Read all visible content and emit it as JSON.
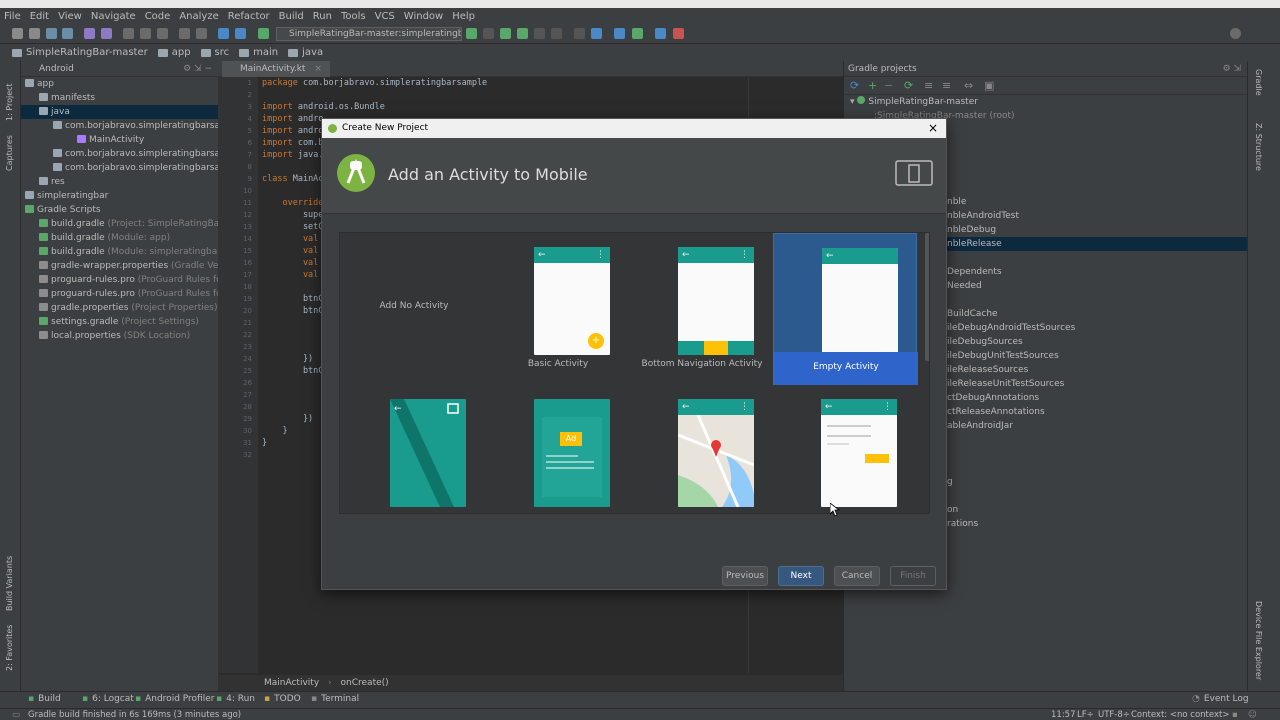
{
  "menu": [
    "File",
    "Edit",
    "View",
    "Navigate",
    "Code",
    "Analyze",
    "Refactor",
    "Build",
    "Run",
    "Tools",
    "VCS",
    "Window",
    "Help"
  ],
  "toolbar": {
    "run_config": "SimpleRatingBar-master:simpleratingbar [..."
  },
  "breadcrumb": [
    "SimpleRatingBar-master",
    "app",
    "src",
    "main",
    "java"
  ],
  "left_strip": {
    "project": "1: Project",
    "captures": "Captures",
    "structure": "7: Structure",
    "build_variants": "Build Variants",
    "favorites": "2: Favorites"
  },
  "project_panel": {
    "mode": "Android",
    "tree": [
      {
        "label": "app",
        "dim": "",
        "indent": 4,
        "type": "folder"
      },
      {
        "label": "manifests",
        "dim": "",
        "indent": 18,
        "type": "folder"
      },
      {
        "label": "java",
        "dim": "",
        "indent": 18,
        "type": "folder",
        "selected": true
      },
      {
        "label": "com.borjabravo.simpleratingbarsampl",
        "dim": "",
        "indent": 32,
        "type": "package"
      },
      {
        "label": "MainActivity",
        "dim": "",
        "indent": 56,
        "type": "kotlin"
      },
      {
        "label": "com.borjabravo.simpleratingbarsampl",
        "dim": "",
        "indent": 32,
        "type": "package"
      },
      {
        "label": "com.borjabravo.simpleratingbarsampl",
        "dim": "",
        "indent": 32,
        "type": "package"
      },
      {
        "label": "res",
        "dim": "",
        "indent": 18,
        "type": "folder"
      },
      {
        "label": "simpleratingbar",
        "dim": "",
        "indent": 4,
        "type": "folder"
      },
      {
        "label": "Gradle Scripts",
        "dim": "",
        "indent": 4,
        "type": "gradle"
      },
      {
        "label": "build.gradle",
        "dim": " (Project: SimpleRatingBar-ma",
        "indent": 18,
        "type": "gradle"
      },
      {
        "label": "build.gradle",
        "dim": " (Module: app)",
        "indent": 18,
        "type": "gradle"
      },
      {
        "label": "build.gradle",
        "dim": " (Module: simpleratingbar)",
        "indent": 18,
        "type": "gradle"
      },
      {
        "label": "gradle-wrapper.properties",
        "dim": " (Gradle Version)",
        "indent": 18,
        "type": "file"
      },
      {
        "label": "proguard-rules.pro",
        "dim": " (ProGuard Rules for ap",
        "indent": 18,
        "type": "file"
      },
      {
        "label": "proguard-rules.pro",
        "dim": " (ProGuard Rules for sin",
        "indent": 18,
        "type": "file"
      },
      {
        "label": "gradle.properties",
        "dim": " (Project Properties)",
        "indent": 18,
        "type": "file"
      },
      {
        "label": "settings.gradle",
        "dim": " (Project Settings)",
        "indent": 18,
        "type": "gradle"
      },
      {
        "label": "local.properties",
        "dim": " (SDK Location)",
        "indent": 18,
        "type": "file"
      }
    ]
  },
  "editor": {
    "tab": "MainActivity.kt",
    "line_numbers": [
      "1",
      "2",
      "3",
      "4",
      "5",
      "6",
      "7",
      "8",
      "9",
      "10",
      "11",
      "12",
      "13",
      "14",
      "15",
      "16",
      "17",
      "18",
      "19",
      "20",
      "21",
      "22",
      "23",
      "24",
      "25",
      "26",
      "27",
      "28",
      "29",
      "30",
      "31",
      "32"
    ],
    "lines": [
      {
        "kw": "package",
        "rest": " com.borjabravo.simpleratingbarsample"
      },
      {
        "kw": "",
        "rest": ""
      },
      {
        "kw": "import",
        "rest": " android.os.Bundle"
      },
      {
        "kw": "import",
        "rest": " andro"
      },
      {
        "kw": "import",
        "rest": " andro"
      },
      {
        "kw": "import",
        "rest": " com.b"
      },
      {
        "kw": "import",
        "rest": " java."
      },
      {
        "kw": "",
        "rest": ""
      },
      {
        "kw": "class",
        "rest": " MainAc"
      },
      {
        "kw": "",
        "rest": ""
      },
      {
        "kw": "    override",
        "rest": ""
      },
      {
        "kw": "",
        "rest": "        super"
      },
      {
        "kw": "",
        "rest": "        setC"
      },
      {
        "kw": "        val",
        "rest": ""
      },
      {
        "kw": "        val",
        "rest": ""
      },
      {
        "kw": "        val",
        "rest": ""
      },
      {
        "kw": "        val",
        "rest": ""
      },
      {
        "kw": "",
        "rest": ""
      },
      {
        "kw": "",
        "rest": "        btnC"
      },
      {
        "kw": "",
        "rest": "        btnC"
      },
      {
        "kw": "",
        "rest": ""
      },
      {
        "kw": "",
        "rest": ""
      },
      {
        "kw": "",
        "rest": ""
      },
      {
        "kw": "",
        "rest": "        })"
      },
      {
        "kw": "",
        "rest": "        btnC"
      },
      {
        "kw": "",
        "rest": ""
      },
      {
        "kw": "",
        "rest": ""
      },
      {
        "kw": "",
        "rest": ""
      },
      {
        "kw": "",
        "rest": "        })"
      },
      {
        "kw": "",
        "rest": "    }"
      },
      {
        "kw": "",
        "rest": "}"
      },
      {
        "kw": "",
        "rest": ""
      }
    ],
    "footer_class": "MainActivity",
    "footer_method": "onCreate()"
  },
  "gradle_panel": {
    "title": "Gradle projects",
    "root": "SimpleRatingBar-master",
    "root_child": ":SimpleRatingBar-master (root)",
    "tasks": [
      "nble",
      "nbleAndroidTest",
      "nbleDebug",
      "nbleRelease",
      "",
      "Dependents",
      "Needed",
      "",
      "BuildCache",
      "ileDebugAndroidTestSources",
      "ileDebugSources",
      "ileDebugUnitTestSources",
      "ileReleaseSources",
      "ileReleaseUnitTestSources",
      "ctDebugAnnotations",
      "ctReleaseAnnotations",
      "ableAndroidJar",
      "",
      "",
      "",
      "g",
      "",
      "on",
      "rations"
    ],
    "selected_task": "nbleRelease"
  },
  "right_strip": {
    "gradle": "Gradle",
    "structure": "Z: Structure",
    "device": "Device File Explorer"
  },
  "dialog": {
    "window_title": "Create New Project",
    "heading": "Add an Activity to Mobile",
    "tiles": [
      {
        "label": "Add No Activity"
      },
      {
        "label": "Basic Activity"
      },
      {
        "label": "Bottom Navigation Activity"
      },
      {
        "label": "Empty Activity"
      }
    ],
    "ad_label": "Ad",
    "buttons": {
      "previous": "Previous",
      "next": "Next",
      "cancel": "Cancel",
      "finish": "Finish"
    }
  },
  "bottom_tabs": [
    "Build",
    "6: Logcat",
    "Android Profiler",
    "4: Run",
    "TODO",
    "Terminal"
  ],
  "event_log": "Event Log",
  "status": {
    "message": "Gradle build finished in 6s 169ms (3 minutes ago)",
    "position": "11:57",
    "line_sep": "LF÷",
    "encoding": "UTF-8÷",
    "context": "Context: <no context>"
  },
  "colors": {
    "accent": "#199b8d",
    "selection": "#2f65ca",
    "amber": "#ffc107"
  }
}
